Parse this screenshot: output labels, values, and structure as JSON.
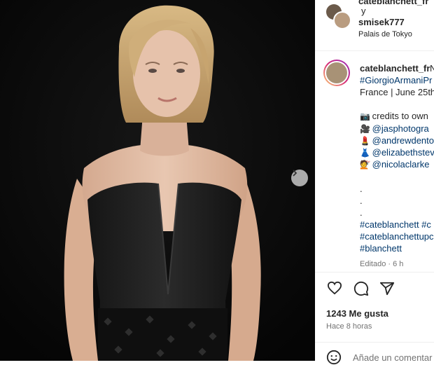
{
  "header": {
    "top_username_partial": "cateblanchett_fr",
    "joiner": "y",
    "second_username": "smisek777",
    "location": "Palais de Tokyo"
  },
  "caption": {
    "username": "cateblanchett_fr",
    "line1_cut": "N",
    "line2": "#GiorgioArmaniPr",
    "line3": "France | June 25th",
    "credits": [
      {
        "icon": "camera",
        "glyph": "📷",
        "text": "credits to own"
      },
      {
        "icon": "movie-camera",
        "glyph": "🎥",
        "text": "@jasphotogra"
      },
      {
        "icon": "lipstick",
        "glyph": "💄",
        "text": "@andrewdento"
      },
      {
        "icon": "dress",
        "glyph": "👗",
        "text": "@elizabethstev"
      },
      {
        "icon": "haircut",
        "glyph": "💇",
        "text": "@nicolaclarke"
      }
    ],
    "dots": [
      ".",
      ".",
      "."
    ],
    "hashtags": [
      "#cateblanchett #c",
      "#cateblanchettupc",
      "#blanchett"
    ],
    "edited": "Editado · 6 h"
  },
  "actions": {
    "icons": [
      "heart-icon",
      "comment-icon",
      "share-icon"
    ]
  },
  "likes": "1243 Me gusta",
  "time_ago": "Hace 8 horas",
  "comment": {
    "placeholder": "Añade un comentar"
  },
  "colors": {
    "link": "#00376b",
    "text": "#262626",
    "muted": "#737373",
    "photo_bg": "#0b0b0b"
  }
}
